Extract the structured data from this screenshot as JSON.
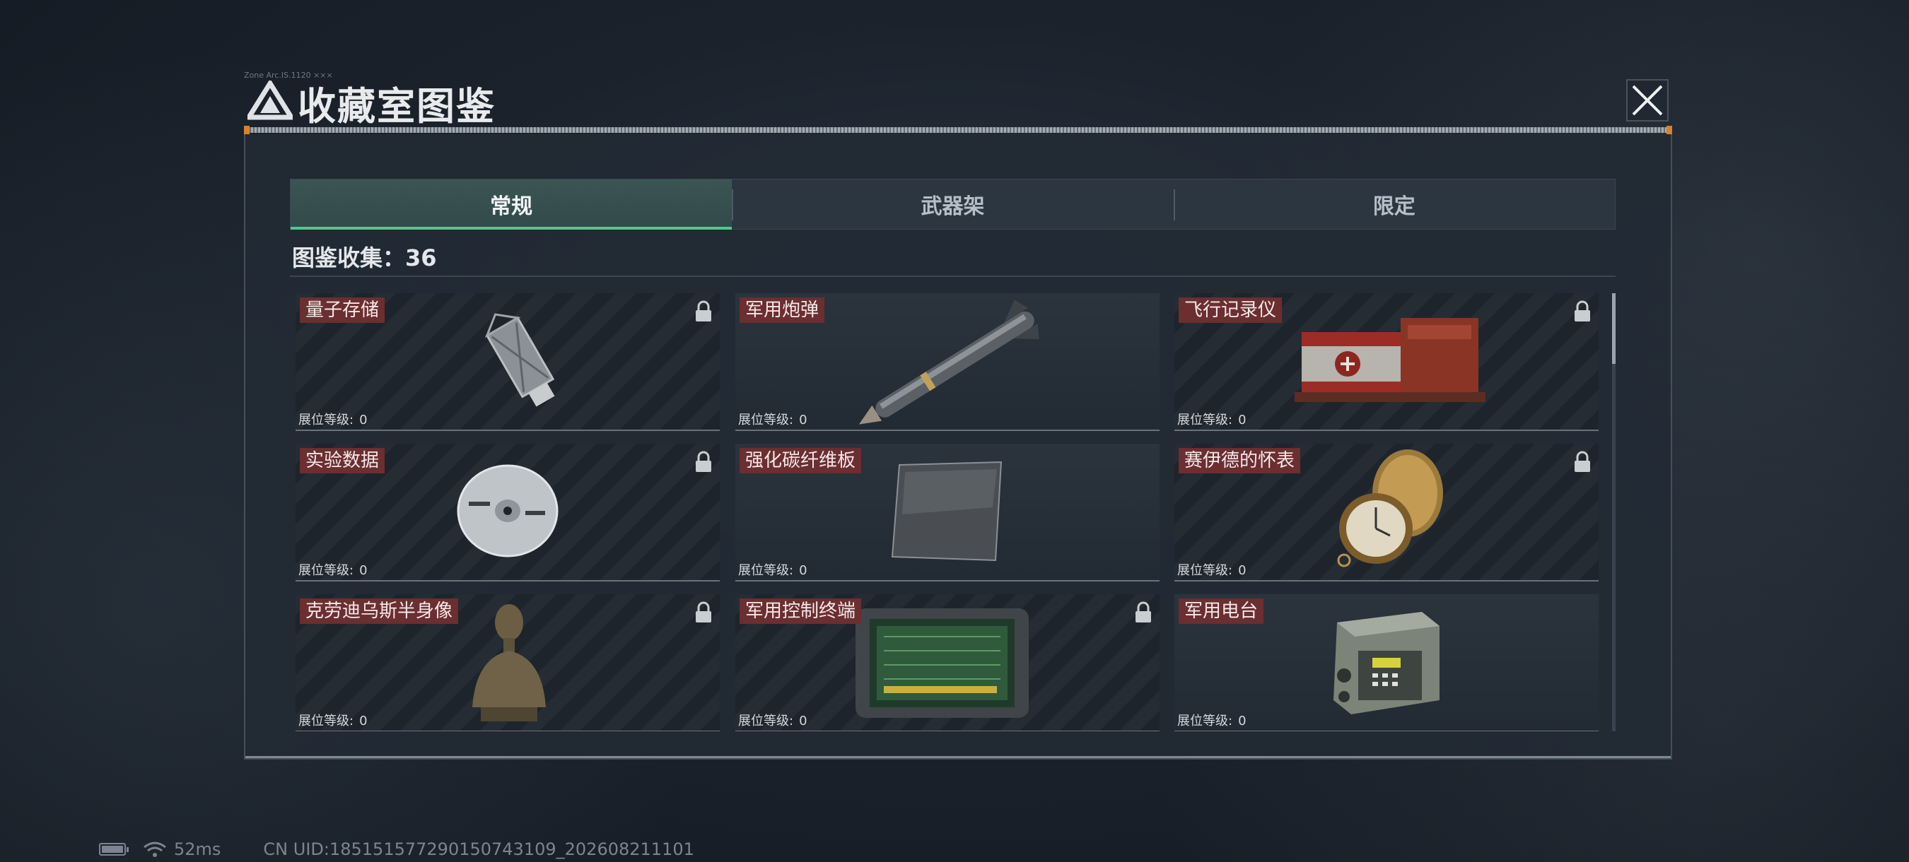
{
  "modal": {
    "title": "收藏室图鉴",
    "header_small_text": "Zone  Arc.IS.1120  ×××",
    "close_icon": "close-icon"
  },
  "tabs": [
    {
      "label": "常规",
      "active": true
    },
    {
      "label": "武器架",
      "active": false
    },
    {
      "label": "限定",
      "active": false
    }
  ],
  "collection": {
    "label": "图鉴收集：",
    "count": "36"
  },
  "level_label": "展位等级:",
  "items": [
    {
      "name": "量子存储",
      "level": "0",
      "locked": true,
      "icon": "usb-storage-icon"
    },
    {
      "name": "军用炮弹",
      "level": "0",
      "locked": false,
      "icon": "missile-icon"
    },
    {
      "name": "飞行记录仪",
      "level": "0",
      "locked": true,
      "icon": "flight-recorder-icon"
    },
    {
      "name": "实验数据",
      "level": "0",
      "locked": true,
      "icon": "disc-icon"
    },
    {
      "name": "强化碳纤维板",
      "level": "0",
      "locked": false,
      "icon": "carbon-plate-icon"
    },
    {
      "name": "赛伊德的怀表",
      "level": "0",
      "locked": true,
      "icon": "pocket-watch-icon"
    },
    {
      "name": "克劳迪乌斯半身像",
      "level": "0",
      "locked": true,
      "icon": "bust-icon"
    },
    {
      "name": "军用控制终端",
      "level": "0",
      "locked": true,
      "icon": "control-terminal-icon"
    },
    {
      "name": "军用电台",
      "level": "0",
      "locked": false,
      "icon": "radio-icon"
    }
  ],
  "scroll": {
    "position": 0.0
  },
  "status_bar": {
    "battery_level": 1.0,
    "ping": "52ms",
    "uid": "CN UID:185151577290150743109_202608211101"
  },
  "colors": {
    "tab_active_underline": "#4ec98e",
    "item_name_bg": "#6b2e31",
    "accent_orange": "#d9822b"
  }
}
